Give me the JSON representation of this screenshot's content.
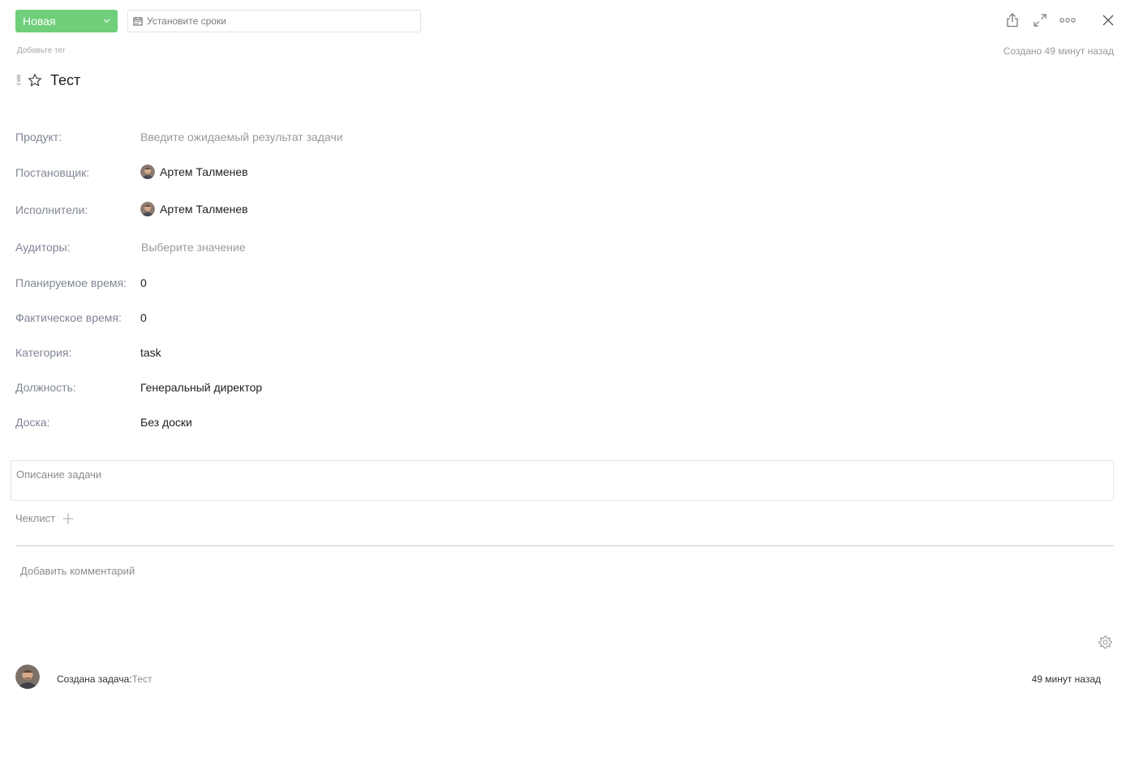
{
  "header": {
    "status_label": "Новая",
    "dates_placeholder": "Установите сроки",
    "tag_placeholder": "Добавьте тег",
    "created_at": "Создано 49 минут назад"
  },
  "task": {
    "priority_symbol": "!!",
    "title": "Тест"
  },
  "fields": {
    "product_label": "Продукт:",
    "product_placeholder": "Введите ожидаемый результат задачи",
    "author_label": "Постановщик:",
    "author_name": "Артем Талменев",
    "assignees_label": "Исполнители:",
    "assignee_name": "Артем Талменев",
    "auditors_label": "Аудиторы:",
    "auditors_placeholder": "Выберите значение",
    "planned_time_label": "Планируемое время:",
    "planned_time_value": "0",
    "actual_time_label": "Фактическое время:",
    "actual_time_value": "0",
    "category_label": "Категория:",
    "category_value": "task",
    "position_label": "Должность:",
    "position_value": "Генеральный директор",
    "board_label": "Доска:",
    "board_value": "Без доски"
  },
  "description": {
    "placeholder": "Описание задачи"
  },
  "checklist": {
    "label": "Чеклист"
  },
  "comments": {
    "placeholder": "Добавить комментарий"
  },
  "activity": {
    "action": "Создана задача:",
    "subject": "Тест",
    "time": "49 минут назад"
  },
  "colors": {
    "status_green": "#6fcf7a",
    "label_gray": "#808695"
  },
  "icons": [
    "chevron-down-icon",
    "calendar-icon",
    "share-icon",
    "expand-icon",
    "more-icon",
    "close-icon",
    "star-icon",
    "plus-icon",
    "gear-icon"
  ]
}
